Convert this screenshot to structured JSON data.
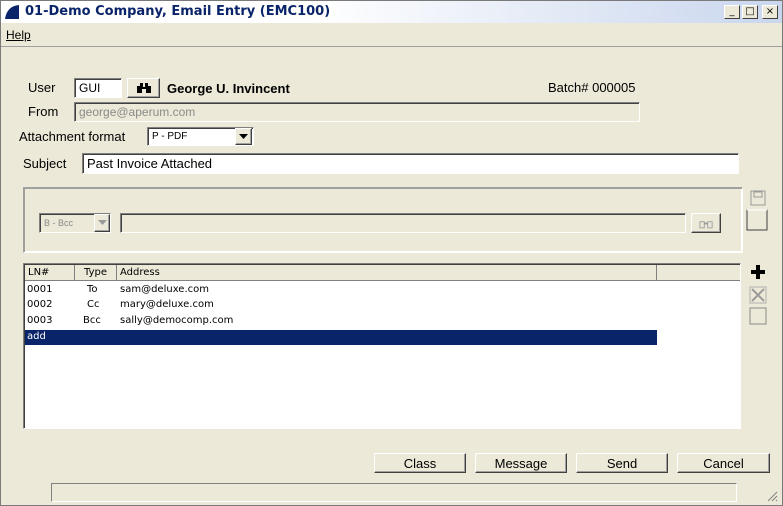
{
  "window": {
    "title": "01-Demo Company, Email Entry (EMC100)",
    "min": "_",
    "max": "□",
    "close": "×"
  },
  "menu": {
    "help": "Help"
  },
  "form": {
    "user_label": "User",
    "user_value": "GUI",
    "user_name": "George U. Invincent",
    "batch": "Batch# 000005",
    "from_label": "From",
    "from_value": "george@aperum.com",
    "attach_label": "Attachment format",
    "attach_value": "P - PDF",
    "subject_label": "Subject",
    "subject_value": "Past Invoice Attached"
  },
  "recipient_editor": {
    "type_value": "B - Bcc",
    "address_value": ""
  },
  "grid": {
    "headers": [
      "LN#",
      "Type",
      "Address"
    ],
    "rows": [
      {
        "ln": "0001",
        "type": "To",
        "address": "sam@deluxe.com"
      },
      {
        "ln": "0002",
        "type": "Cc",
        "address": "mary@deluxe.com"
      },
      {
        "ln": "0003",
        "type": "Bcc",
        "address": "sally@democomp.com"
      }
    ],
    "add_row": "add",
    "selection_color": "#0a246a"
  },
  "buttons": {
    "class": "Class",
    "message": "Message",
    "send": "Send",
    "cancel": "Cancel"
  },
  "icons": {
    "binoculars": "binoculars-icon",
    "add": "plus-icon",
    "delete": "x-icon",
    "blank": "blank-icon"
  }
}
